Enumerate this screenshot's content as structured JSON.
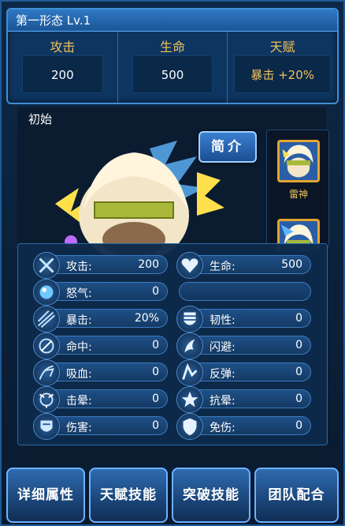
{
  "header": {
    "title": "第一形态 Lv.1"
  },
  "summary": [
    {
      "label": "攻击",
      "value": "200"
    },
    {
      "label": "生命",
      "value": "500"
    },
    {
      "label": "天赋",
      "value": "暴击 +20%"
    }
  ],
  "stage": "初始",
  "intro_button": "简介",
  "side_list": [
    {
      "name": "雷神"
    }
  ],
  "attributes": {
    "attack": {
      "label": "攻击:",
      "value": "200",
      "icon": "crossed-swords-icon"
    },
    "hp": {
      "label": "生命:",
      "value": "500",
      "icon": "heart-icon"
    },
    "rage": {
      "label": "怒气:",
      "value": "0",
      "icon": "orb-icon"
    },
    "crit": {
      "label": "暴击:",
      "value": "20%",
      "icon": "slash-icon"
    },
    "toughness": {
      "label": "韧性:",
      "value": "0",
      "icon": "armor-icon"
    },
    "hit": {
      "label": "命中:",
      "value": "0",
      "icon": "target-icon"
    },
    "dodge": {
      "label": "闪避:",
      "value": "0",
      "icon": "dodge-icon"
    },
    "lifesteal": {
      "label": "吸血:",
      "value": "0",
      "icon": "lifesteal-icon"
    },
    "reflect": {
      "label": "反弹:",
      "value": "0",
      "icon": "reflect-icon"
    },
    "stun": {
      "label": "击晕:",
      "value": "0",
      "icon": "stun-icon"
    },
    "stun_res": {
      "label": "抗晕:",
      "value": "0",
      "icon": "stun-resist-icon"
    },
    "damage": {
      "label": "伤害:",
      "value": "0",
      "icon": "damage-icon"
    },
    "immunity": {
      "label": "免伤:",
      "value": "0",
      "icon": "shield-icon"
    }
  },
  "tabs": [
    "详细属性",
    "天赋技能",
    "突破技能",
    "团队配合"
  ],
  "colors": {
    "gold": "#f0c25a",
    "panel_blue": "#0e3560",
    "border_blue": "#3f8fd8"
  }
}
